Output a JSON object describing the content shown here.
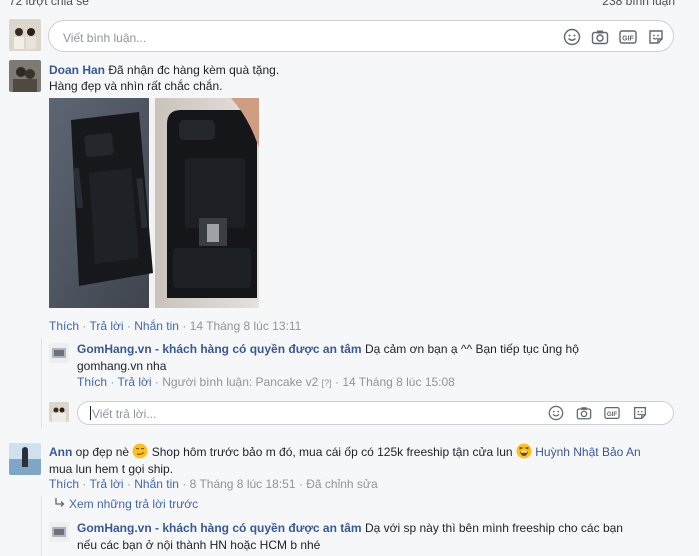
{
  "top": {
    "shares": "72 lượt chia sẻ",
    "comments_count": "238 bình luận"
  },
  "composer": {
    "placeholder": "Viết bình luận...",
    "icons": [
      "emoji-icon",
      "camera-icon",
      "gif-icon",
      "sticker-icon"
    ]
  },
  "comments": [
    {
      "author": "Doan Han",
      "text_line1": "Đã nhận đc hàng kèm quà tặng.",
      "text_line2": "Hàng đẹp và nhìn rất chắc chắn.",
      "like": "Thích",
      "reply": "Trả lời",
      "message": "Nhắn tin",
      "timestamp": "14 Tháng 8 lúc 13:11",
      "replies": [
        {
          "author": "GomHang.vn - khách hàng có quyền được an tâm",
          "text_line1": "Dạ cảm ơn bạn ạ ^^ Bạn tiếp tục ủng hộ",
          "text_line2": "gomhang.vn nha",
          "like": "Thích",
          "reply": "Trả lời",
          "commenter_label": "Người bình luận: Pancake v2",
          "commenter_tag": "[?]",
          "timestamp": "14 Tháng 8 lúc 15:08"
        }
      ],
      "reply_placeholder": "Viết trả lời..."
    },
    {
      "author": "Ann",
      "text_part1": "op đẹp nè",
      "text_part2": "Shop hôm trước bảo m đó, mua cái ốp có 125k freeship tận cửa lun",
      "mention": "Huỳnh Nhật Bảo An",
      "text_line2": "mua lun hem t gọi ship.",
      "like": "Thích",
      "reply": "Trả lời",
      "message": "Nhắn tin",
      "timestamp": "8 Tháng 8 lúc 18:51",
      "edited": "Đã chỉnh sửa",
      "see_previous": "Xem những trả lời trước",
      "reply_author": "GomHang.vn - khách hàng có quyền được an tâm",
      "reply_text_line1": "Dạ với sp này thì bên mình freeship cho các bạn",
      "reply_text_line2": "nếu các bạn ở nội thành HN hoặc HCM b nhé"
    }
  ],
  "colors": {
    "link": "#385898",
    "action": "#4267b2",
    "meta": "#90949c",
    "background": "#f6f7f9"
  }
}
